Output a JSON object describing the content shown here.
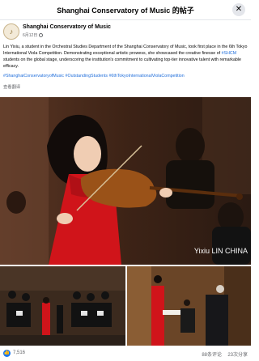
{
  "header": {
    "title": "Shanghai Conservatory of Music 的帖子",
    "close_glyph": "✕"
  },
  "author": {
    "name": "Shanghai Conservatory of Music",
    "date": "6月12日",
    "avatar_glyph": "♪"
  },
  "post": {
    "text_before_link": "Lin Yixiu, a student in the Orchestral Studies Department of the Shanghai Conservatory of Music, took first place in the 6th Tokyo International Viola Competition. Demonstrating exceptional artistic prowess, she showcased the creative finesse of ",
    "link": "#SHCM",
    "text_after_link": " students on the global stage, underscoring the institution's commitment to cultivating top-tier innovative talent with remarkable efficacy.",
    "hashtags": "#ShanghaiConservatoryofMusic #OutstandingStudents #6thTokyoInternationalViolaCompetition",
    "see_translation": "查看翻译"
  },
  "photos": {
    "main_caption": "Yixiu LIN   CHINA"
  },
  "footer": {
    "like_icon": "👍",
    "likes": "7,516",
    "comments": "88条评论",
    "shares": "23次分享"
  },
  "colors": {
    "link": "#216fdb",
    "like_blue": "#1877f2",
    "dress_red": "#d0141a"
  }
}
